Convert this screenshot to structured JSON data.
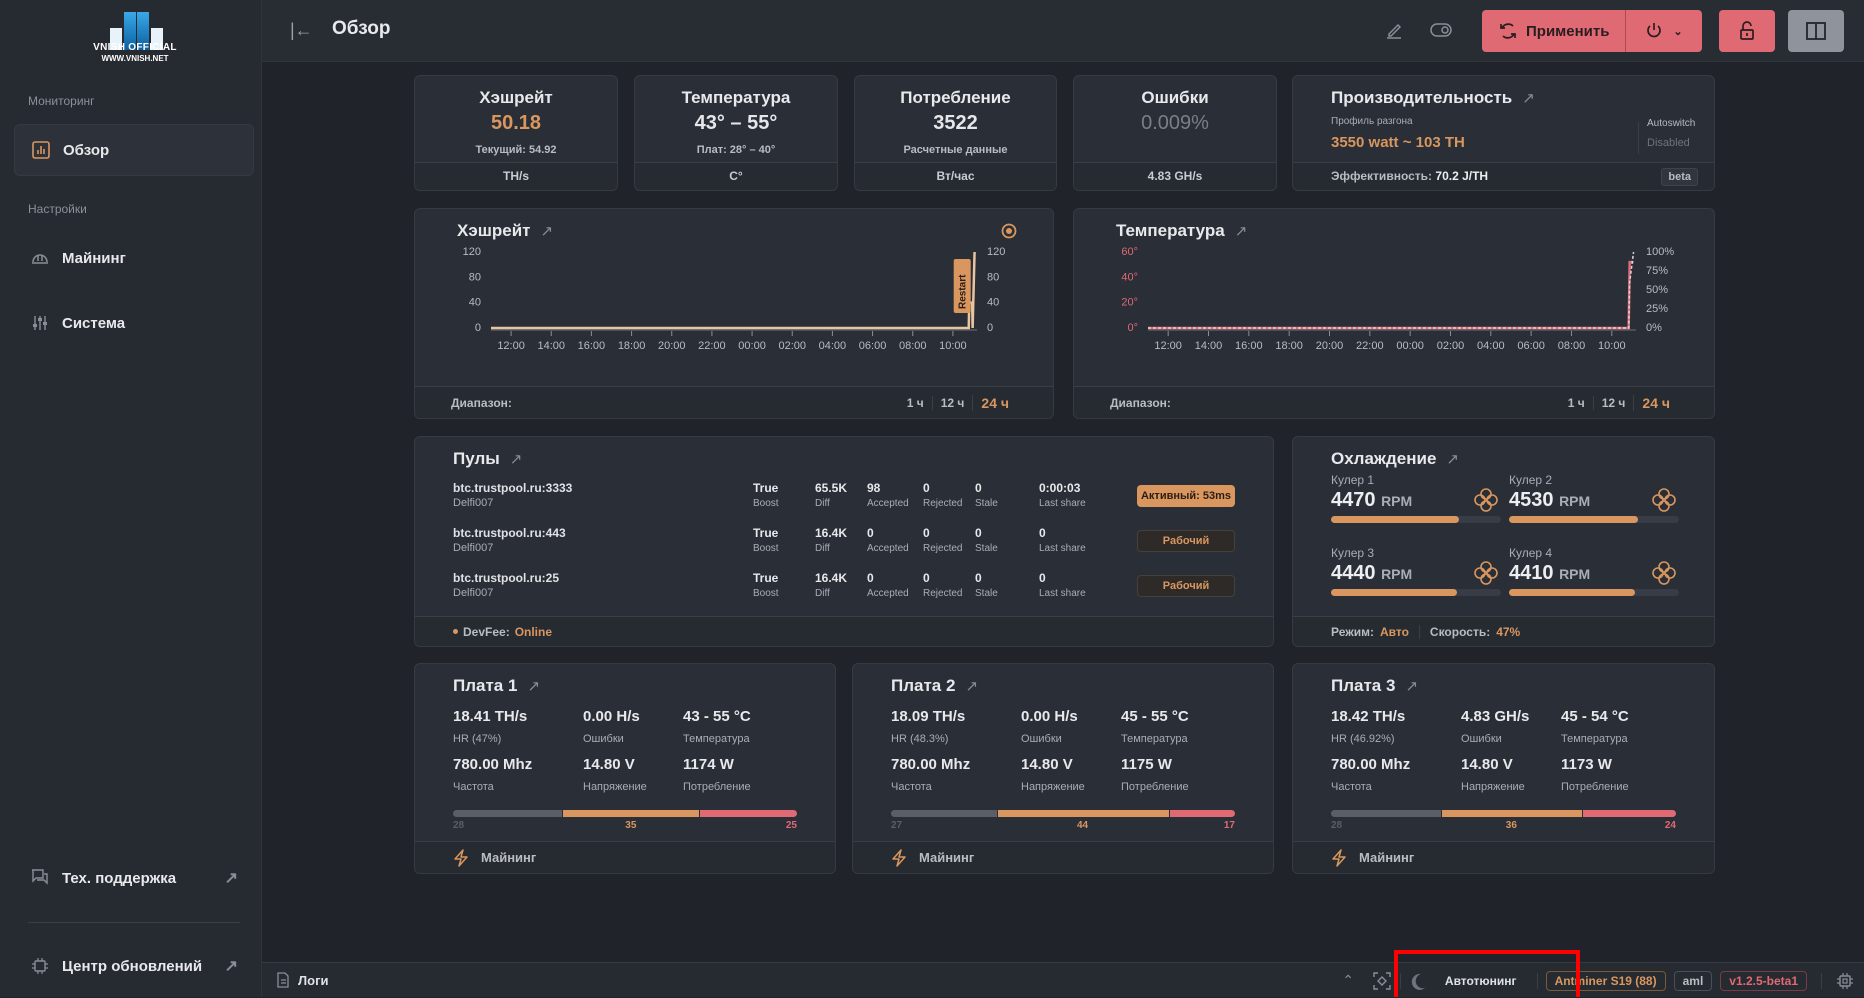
{
  "brand": {
    "title": "VNISH OFFICIAL",
    "url": "WWW.VNISH.NET"
  },
  "sidebar": {
    "sections": [
      {
        "label": "Мониторинг"
      },
      {
        "label": "Настройки"
      }
    ],
    "items": [
      {
        "label": "Обзор",
        "icon": "chart-bars-icon",
        "active": true
      },
      {
        "label": "Майнинг",
        "icon": "hard-hat-icon"
      },
      {
        "label": "Система",
        "icon": "sliders-icon"
      }
    ],
    "bottom": [
      {
        "label": "Тех. поддержка",
        "icon": "chat-icon"
      },
      {
        "label": "Центр обновлений",
        "icon": "chip-icon"
      }
    ]
  },
  "header": {
    "title": "Обзор",
    "apply_label": "Применить"
  },
  "stats": {
    "hashrate": {
      "title": "Хэшрейт",
      "value": "50.18",
      "sub": "Текущий: 54.92",
      "unit": "TH/s"
    },
    "temperature": {
      "title": "Температура",
      "value": "43° – 55°",
      "sub": "Плат: 28° – 40°",
      "unit": "C°"
    },
    "power": {
      "title": "Потребление",
      "value": "3522",
      "sub": "Расчетные данные",
      "unit": "Вт/час"
    },
    "errors": {
      "title": "Ошибки",
      "value": "0.009%",
      "unit": "4.83 GH/s"
    },
    "performance": {
      "title": "Производительность",
      "profile_label": "Профиль разгона",
      "profile_value": "3550 watt ~ 103 TH",
      "autoswitch_label": "Autoswitch",
      "autoswitch_value": "Disabled",
      "efficiency_label": "Эффективность:",
      "efficiency_value": "70.2 J/TH",
      "badge": "beta"
    }
  },
  "chart_data": [
    {
      "type": "line",
      "title": "Хэшрейт",
      "x": [
        "12:00",
        "14:00",
        "16:00",
        "18:00",
        "20:00",
        "22:00",
        "00:00",
        "02:00",
        "04:00",
        "06:00",
        "08:00",
        "10:00"
      ],
      "yticks": [
        "0",
        "40",
        "80",
        "120"
      ],
      "ylim": [
        0,
        120
      ],
      "series": [
        {
          "name": "hashrate",
          "points": [
            [
              0,
              0
            ],
            [
              0.983,
              0
            ],
            [
              0.984,
              40
            ],
            [
              0.99,
              40
            ],
            [
              0.991,
              0
            ],
            [
              0.995,
              120
            ]
          ]
        }
      ],
      "annotation": "Restart",
      "range_label": "Диапазон:",
      "ranges": [
        "1 ч",
        "12 ч",
        "24 ч"
      ],
      "active_range": "24 ч"
    },
    {
      "type": "line",
      "title": "Температура",
      "x": [
        "12:00",
        "14:00",
        "16:00",
        "18:00",
        "20:00",
        "22:00",
        "00:00",
        "02:00",
        "04:00",
        "06:00",
        "08:00",
        "10:00"
      ],
      "yticks_left": [
        "0°",
        "20°",
        "40°",
        "60°"
      ],
      "yticks_right": [
        "0%",
        "25%",
        "50%",
        "75%",
        "100%"
      ],
      "ylim": [
        0,
        60
      ],
      "series": [
        {
          "name": "temp",
          "points": [
            [
              0,
              0
            ],
            [
              0.985,
              0
            ],
            [
              0.987,
              52
            ],
            [
              0.995,
              52
            ]
          ]
        },
        {
          "name": "fan",
          "points": [
            [
              0,
              0
            ],
            [
              0.985,
              0
            ],
            [
              0.987,
              60
            ],
            [
              0.995,
              100
            ]
          ]
        }
      ],
      "range_label": "Диапазон:",
      "ranges": [
        "1 ч",
        "12 ч",
        "24 ч"
      ],
      "active_range": "24 ч"
    }
  ],
  "pools": {
    "title": "Пулы",
    "col_labels": [
      "Boost",
      "Diff",
      "Accepted",
      "Rejected",
      "Stale",
      "Last share"
    ],
    "rows": [
      {
        "url": "btc.trustpool.ru:3333",
        "user": "Delfi007",
        "values": [
          "True",
          "65.5K",
          "98",
          "0",
          "0",
          "0:00:03"
        ],
        "status": "Активный: 53ms",
        "active": true
      },
      {
        "url": "btc.trustpool.ru:443",
        "user": "Delfi007",
        "values": [
          "True",
          "16.4K",
          "0",
          "0",
          "0",
          "0"
        ],
        "status": "Рабочий",
        "active": false
      },
      {
        "url": "btc.trustpool.ru:25",
        "user": "Delfi007",
        "values": [
          "True",
          "16.4K",
          "0",
          "0",
          "0",
          "0"
        ],
        "status": "Рабочий",
        "active": false
      }
    ],
    "devfee_label": "DevFee:",
    "devfee_value": "Online"
  },
  "cooling": {
    "title": "Охлаждение",
    "fans": [
      {
        "name": "Кулер 1",
        "rpm": "4470",
        "unit": "RPM",
        "level": 0.75
      },
      {
        "name": "Кулер 2",
        "rpm": "4530",
        "unit": "RPM",
        "level": 0.76
      },
      {
        "name": "Кулер 3",
        "rpm": "4440",
        "unit": "RPM",
        "level": 0.74
      },
      {
        "name": "Кулер 4",
        "rpm": "4410",
        "unit": "RPM",
        "level": 0.74
      }
    ],
    "mode_label": "Режим:",
    "mode_value": "Авто",
    "speed_label": "Скорость:",
    "speed_value": "47%"
  },
  "boards": [
    {
      "title": "Плата 1",
      "hr": "18.41 TH/s",
      "hr_label": "HR (47%)",
      "err": "0.00 H/s",
      "err_label": "Ошибки",
      "temp": "43 - 55 °C",
      "temp_label": "Температура",
      "freq": "780.00 Mhz",
      "freq_label": "Частота",
      "volt": "14.80 V",
      "volt_label": "Напряжение",
      "power": "1174 W",
      "power_label": "Потребление",
      "chips": [
        28,
        35,
        25
      ],
      "footer": "Майнинг"
    },
    {
      "title": "Плата 2",
      "hr": "18.09 TH/s",
      "hr_label": "HR (48.3%)",
      "err": "0.00 H/s",
      "err_label": "Ошибки",
      "temp": "45 - 55 °C",
      "temp_label": "Температура",
      "freq": "780.00 Mhz",
      "freq_label": "Частота",
      "volt": "14.80 V",
      "volt_label": "Напряжение",
      "power": "1175 W",
      "power_label": "Потребление",
      "chips": [
        27,
        44,
        17
      ],
      "footer": "Майнинг"
    },
    {
      "title": "Плата 3",
      "hr": "18.42 TH/s",
      "hr_label": "HR (46.92%)",
      "err": "4.83 GH/s",
      "err_label": "Ошибки",
      "temp": "45 - 54 °C",
      "temp_label": "Температура",
      "freq": "780.00 Mhz",
      "freq_label": "Частота",
      "volt": "14.80 V",
      "volt_label": "Напряжение",
      "power": "1173 W",
      "power_label": "Потребление",
      "chips": [
        28,
        36,
        24
      ],
      "footer": "Майнинг"
    }
  ],
  "statusbar": {
    "logs": "Логи",
    "autotune": "Автотюнинг",
    "model": "Antminer S19 (88)",
    "aml": "aml",
    "version": "v1.2.5-beta1"
  },
  "colors": {
    "accent": "#d9975f",
    "danger": "#e06a73",
    "grey": "#5a5e68"
  }
}
